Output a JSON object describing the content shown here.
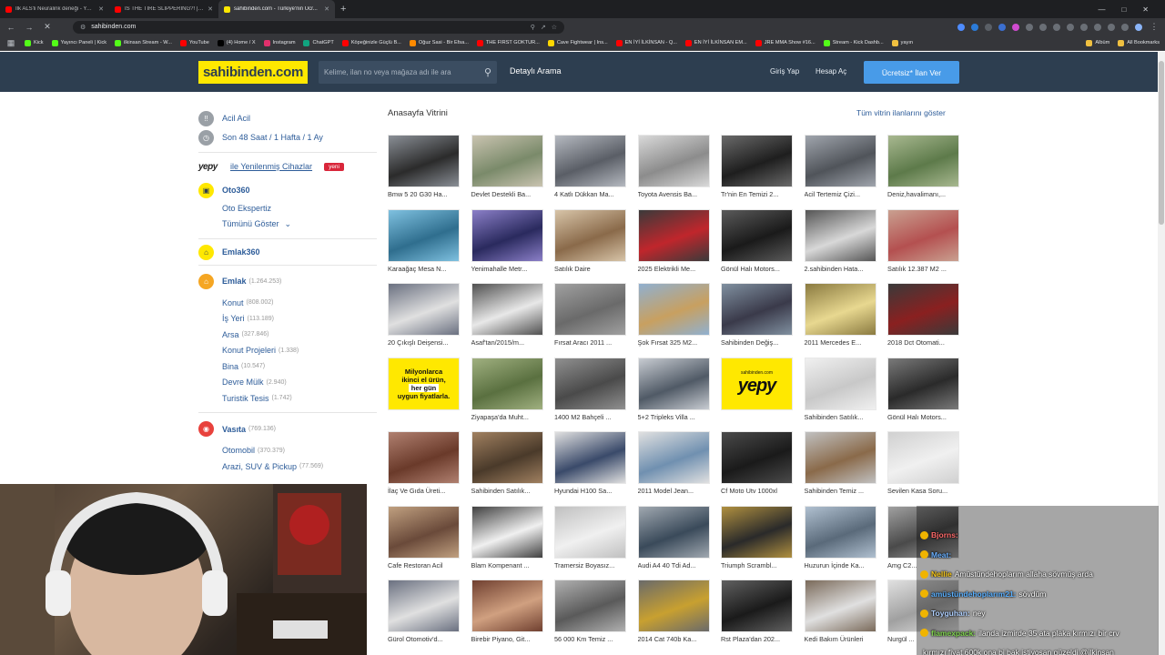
{
  "browser": {
    "tabs": [
      {
        "title": "İlk ALS'li Neuralink deneği - YouTube",
        "color": "#ff0000"
      },
      {
        "title": "IS THE TIRE SLIPPERING?! | 5Sriders | ...",
        "color": "#ff0000"
      },
      {
        "title": "sahibinden.com - Türkiye'nin Ücr...",
        "color": "#ffe800",
        "active": true
      }
    ],
    "new_tab": "+",
    "url": "sahibinden.com",
    "bookmarks": [
      {
        "label": "Kick",
        "color": "#53fc18"
      },
      {
        "label": "Yayıncı Paneli | Kick",
        "color": "#53fc18"
      },
      {
        "label": "ilkinsan Stream - W...",
        "color": "#53fc18"
      },
      {
        "label": "YouTube",
        "color": "#ff0000"
      },
      {
        "label": "(4) Home / X",
        "color": "#000000"
      },
      {
        "label": "Instagram",
        "color": "#e1306c"
      },
      {
        "label": "ChatGPT",
        "color": "#10a37f"
      },
      {
        "label": "Köpeğinizle Güçlü B...",
        "color": "#ff0000"
      },
      {
        "label": "Oğuz Sasi - Bir Efsa...",
        "color": "#ff8a00"
      },
      {
        "label": "THE FIRST GOKTUR...",
        "color": "#ff0000"
      },
      {
        "label": "Cave Fightwear | Ins...",
        "color": "#ffd700"
      },
      {
        "label": "EN İYİ İLKİNSAN - Q...",
        "color": "#ff0000"
      },
      {
        "label": "EN İYİ İLKİNSAN EM...",
        "color": "#ff0000"
      },
      {
        "label": "JRE MMA Show #16...",
        "color": "#ff0000"
      },
      {
        "label": "Stream - Kick Dashb...",
        "color": "#53fc18"
      },
      {
        "label": "yayın",
        "color": "#f0c040"
      }
    ],
    "bookmarks_extra": [
      "Albüm",
      "All Bookmarks"
    ]
  },
  "header": {
    "logo": "sahibinden.com",
    "search_placeholder": "Kelime, ilan no veya mağaza adı ile ara",
    "detailed_search": "Detaylı Arama",
    "login": "Giriş Yap",
    "register": "Hesap Aç",
    "post_ad": "Ücretsiz* İlan Ver"
  },
  "sidebar": {
    "urgent": "Acil Acil",
    "time_filter": "Son 48 Saat / 1 Hafta / 1 Ay",
    "yepy_logo": "yepy",
    "yepy_text": "ile Yenilenmiş Cihazlar",
    "yepy_badge": "yeni",
    "oto360": "Oto360",
    "oto_items": [
      "Oto Ekspertiz",
      "Tümünü Göster"
    ],
    "emlak360": "Emlak360",
    "emlak": {
      "label": "Emlak",
      "count": "(1.264.253)"
    },
    "emlak_items": [
      {
        "label": "Konut",
        "count": "(808.002)"
      },
      {
        "label": "İş Yeri",
        "count": "(113.189)"
      },
      {
        "label": "Arsa",
        "count": "(327.846)"
      },
      {
        "label": "Konut Projeleri",
        "count": "(1.338)"
      },
      {
        "label": "Bina",
        "count": "(10.547)"
      },
      {
        "label": "Devre Mülk",
        "count": "(2.940)"
      },
      {
        "label": "Turistik Tesis",
        "count": "(1.742)"
      }
    ],
    "vasita": {
      "label": "Vasıta",
      "count": "(769.136)"
    },
    "vasita_items": [
      {
        "label": "Otomobil",
        "count": "(370.379)"
      },
      {
        "label": "Arazi, SUV & Pickup",
        "count": "(77.569)"
      }
    ]
  },
  "main": {
    "title": "Anasayfa Vitrini",
    "show_all": "Tüm vitrin ilanlarını göster",
    "cards": [
      {
        "title": "Bmw 5 20 G30 Ha...",
        "c1": "#2b2b2b",
        "c2": "#8a8f96"
      },
      {
        "title": "Devlet Destekli Ba...",
        "c1": "#7a8a6a",
        "c2": "#c9c3b0"
      },
      {
        "title": "4 Katlı Dükkan Ma...",
        "c1": "#5a5e66",
        "c2": "#b5b9c0"
      },
      {
        "title": "Toyota Avensis Ba...",
        "c1": "#8c8c8c",
        "c2": "#d9d9d9"
      },
      {
        "title": "Tr'nin En Temizi 2...",
        "c1": "#1e1e1e",
        "c2": "#6a6a6a"
      },
      {
        "title": "Acil Tertemiz Çizi...",
        "c1": "#50545a",
        "c2": "#a0a5ad"
      },
      {
        "title": "Deniz,havalimanı,...",
        "c1": "#5d7a4a",
        "c2": "#a8b890"
      },
      {
        "title": "Karaağaç Mesa N...",
        "c1": "#2f6e8e",
        "c2": "#7fc1e0"
      },
      {
        "title": "Yenimahalle Metr...",
        "c1": "#2a2a5e",
        "c2": "#8b7fc8"
      },
      {
        "title": "Satılık Daire",
        "c1": "#8a6a4a",
        "c2": "#d7c4a8"
      },
      {
        "title": "2025 Elektrikli Me...",
        "c1": "#c0262c",
        "c2": "#3a3a3a"
      },
      {
        "title": "Gönül Halı Motors...",
        "c1": "#1a1a1a",
        "c2": "#5a5a5a"
      },
      {
        "title": "2.sahibinden Hata...",
        "c1": "#d8d8d8",
        "c2": "#555555"
      },
      {
        "title": "Satılık 12.387 M2 ...",
        "c1": "#b45050",
        "c2": "#c9a090"
      },
      {
        "title": "20 Çıkışlı Deişensi...",
        "c1": "#e0e0e0",
        "c2": "#6a7080"
      },
      {
        "title": "Asaf'tan/2015/m...",
        "c1": "#e8e8e8",
        "c2": "#505050"
      },
      {
        "title": "Fırsat Aracı 2011 ...",
        "c1": "#6a6a6a",
        "c2": "#a0a0a0"
      },
      {
        "title": "Şok Fırsat 325 M2...",
        "c1": "#c8a060",
        "c2": "#90b0d0"
      },
      {
        "title": "Sahibinden Değiş...",
        "c1": "#3a3a4a",
        "c2": "#8090a0"
      },
      {
        "title": "2011 Mercedes E...",
        "c1": "#e8d890",
        "c2": "#8a7a40"
      },
      {
        "title": "2018 Dct Otomati...",
        "c1": "#8a2020",
        "c2": "#3a3a3a"
      },
      {
        "title": "",
        "type": "ad1"
      },
      {
        "title": "Ziyapaşa'da Muht...",
        "c1": "#5a7040",
        "c2": "#a0b080"
      },
      {
        "title": "1400 M2 Bahçeli ...",
        "c1": "#4a4a4a",
        "c2": "#909090"
      },
      {
        "title": "5+2 Tripleks Villa ...",
        "c1": "#505a66",
        "c2": "#c8ccd2"
      },
      {
        "title": "",
        "type": "ad2"
      },
      {
        "title": "Sahibinden Satılık...",
        "c1": "#c8c8c8",
        "c2": "#f0f0f0"
      },
      {
        "title": "Gönül Halı Motors...",
        "c1": "#2a2a2a",
        "c2": "#7a7a7a"
      },
      {
        "title": "İlaç Ve Gıda Üreti...",
        "c1": "#6a3a2a",
        "c2": "#b08070"
      },
      {
        "title": "Sahibinden Satılık...",
        "c1": "#4a3a2a",
        "c2": "#a08060"
      },
      {
        "title": "Hyundai H100 Sa...",
        "c1": "#3a4a6a",
        "c2": "#e0e0e0"
      },
      {
        "title": "2011 Model Jean...",
        "c1": "#7090b0",
        "c2": "#e0e0e0"
      },
      {
        "title": "Cf Moto Utv 1000xl",
        "c1": "#1a1a1a",
        "c2": "#4a4a4a"
      },
      {
        "title": "Sahibinden Temiz ...",
        "c1": "#8a6a4a",
        "c2": "#c0c0c0"
      },
      {
        "title": "Sevilen Kasa Soru...",
        "c1": "#f0f0f0",
        "c2": "#d0d0d0"
      },
      {
        "title": "Cafe Restoran Acil",
        "c1": "#6a4a3a",
        "c2": "#c0a080"
      },
      {
        "title": "Blam Kompenant ...",
        "c1": "#f0f0f0",
        "c2": "#404040"
      },
      {
        "title": "Tramersiz Boyasız...",
        "c1": "#f0f0f0",
        "c2": "#c0c0c0"
      },
      {
        "title": "Audi A4 40 Tdi Ad...",
        "c1": "#3a4a5a",
        "c2": "#a0a8b0"
      },
      {
        "title": "Triumph Scrambl...",
        "c1": "#2a2a2a",
        "c2": "#b09040"
      },
      {
        "title": "Huzurun İçinde Ka...",
        "c1": "#5a6a7a",
        "c2": "#b0c0d0"
      },
      {
        "title": "Amg C2...",
        "c1": "#4a4a4a",
        "c2": "#a0a0a0"
      },
      {
        "title": "Gürol Otomotiv'd...",
        "c1": "#e0e0e0",
        "c2": "#6a7080"
      },
      {
        "title": "Birebir Piyano, Git...",
        "c1": "#d0a080",
        "c2": "#704030"
      },
      {
        "title": "56 000 Km Temiz ...",
        "c1": "#5a5a5a",
        "c2": "#b0b0b0"
      },
      {
        "title": "2014 Cat 740b Ka...",
        "c1": "#c8a030",
        "c2": "#6a6a6a"
      },
      {
        "title": "Rst Plaza'dan 202...",
        "c1": "#1a1a1a",
        "c2": "#606060"
      },
      {
        "title": "Kedi Bakım Ürünleri",
        "c1": "#e0e0e0",
        "c2": "#7a6a5a"
      },
      {
        "title": "Nurgül ...",
        "c1": "#a0a0a0",
        "c2": "#e0e0e0"
      }
    ],
    "ad1_lines": [
      "Milyonlarca",
      "ikinci el ürün,",
      "her gün",
      "uygun fiyatlarla."
    ],
    "ad2_top": "sahibinden.com",
    "ad2_big": "yepy"
  },
  "stream_chat": [
    {
      "user": "",
      "msg": "",
      "color": "#7fd34e"
    },
    {
      "user": "Bjorns:",
      "msg": "",
      "color": "#ff6a6a"
    },
    {
      "user": "Meat:",
      "msg": "",
      "color": "#6ab0ff"
    },
    {
      "user": "Nellie",
      "msg": "Amüstündehoplarım allaha sövmüş arda",
      "color": "#f5c518"
    },
    {
      "user": "amüstündehoplarım21:",
      "msg": "sövdüm",
      "color": "#5ab0ff"
    },
    {
      "user": "Toyguhan:",
      "msg": "ney",
      "color": "#b0d0ff"
    },
    {
      "user": "flamexpack:",
      "msg": "ilanda izmirde 35 ata plaka kırmızı bir crv",
      "color": "#7fd34e"
    },
    {
      "user": "",
      "msg": "kırmızı fiyat 600k ona bi bak istiyosan güzeldi @ilkinsan",
      "color": "#ffffff"
    }
  ]
}
